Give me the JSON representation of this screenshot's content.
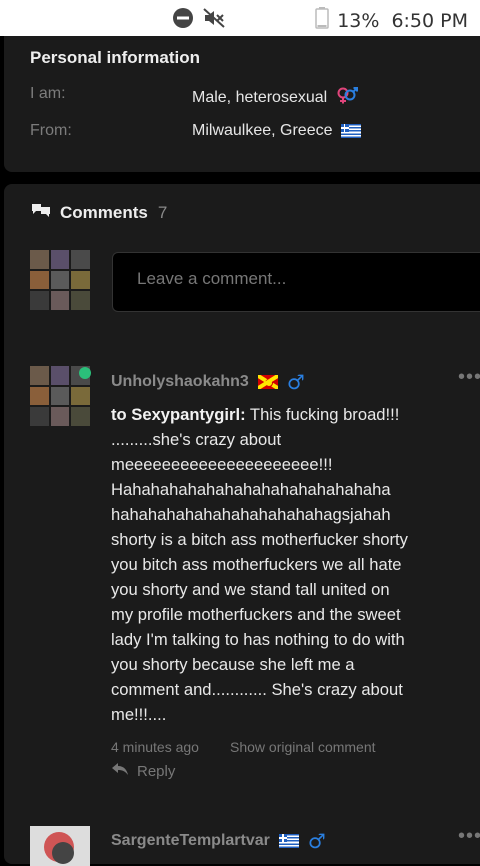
{
  "status_bar": {
    "battery": "13%",
    "time": "6:50 PM"
  },
  "personal_info": {
    "title": "Personal information",
    "rows": [
      {
        "label": "I am:",
        "value": "Male, heterosexual"
      },
      {
        "label": "From:",
        "value": "Milwaulkee, Greece"
      }
    ]
  },
  "comments": {
    "title": "Comments",
    "count": "7",
    "input_placeholder": "Leave a comment...",
    "items": [
      {
        "author": "Unholyshaokahn3",
        "reply_to": "to Sexypantygirl:",
        "text": " This fucking broad!!!\n.........she's crazy about\nmeeeeeeeeeeeeeeeeeeeee!!!\nHahahahahahahahahahahahahahaha\nhahahahahahahahahahahahagsjahah\nshorty is a bitch ass motherfucker shorty\nyou bitch ass motherfuckers we all hate\nyou shorty and we stand tall united on\nmy profile motherfuckers and the sweet\nlady I'm talking to has nothing to do with\nyou shorty because she left me a\ncomment and............ She's crazy about\nme!!!....",
        "time": "4 minutes ago",
        "show_original": "Show original comment",
        "reply_label": "Reply"
      },
      {
        "author": "SargenteTemplartvar"
      }
    ]
  }
}
